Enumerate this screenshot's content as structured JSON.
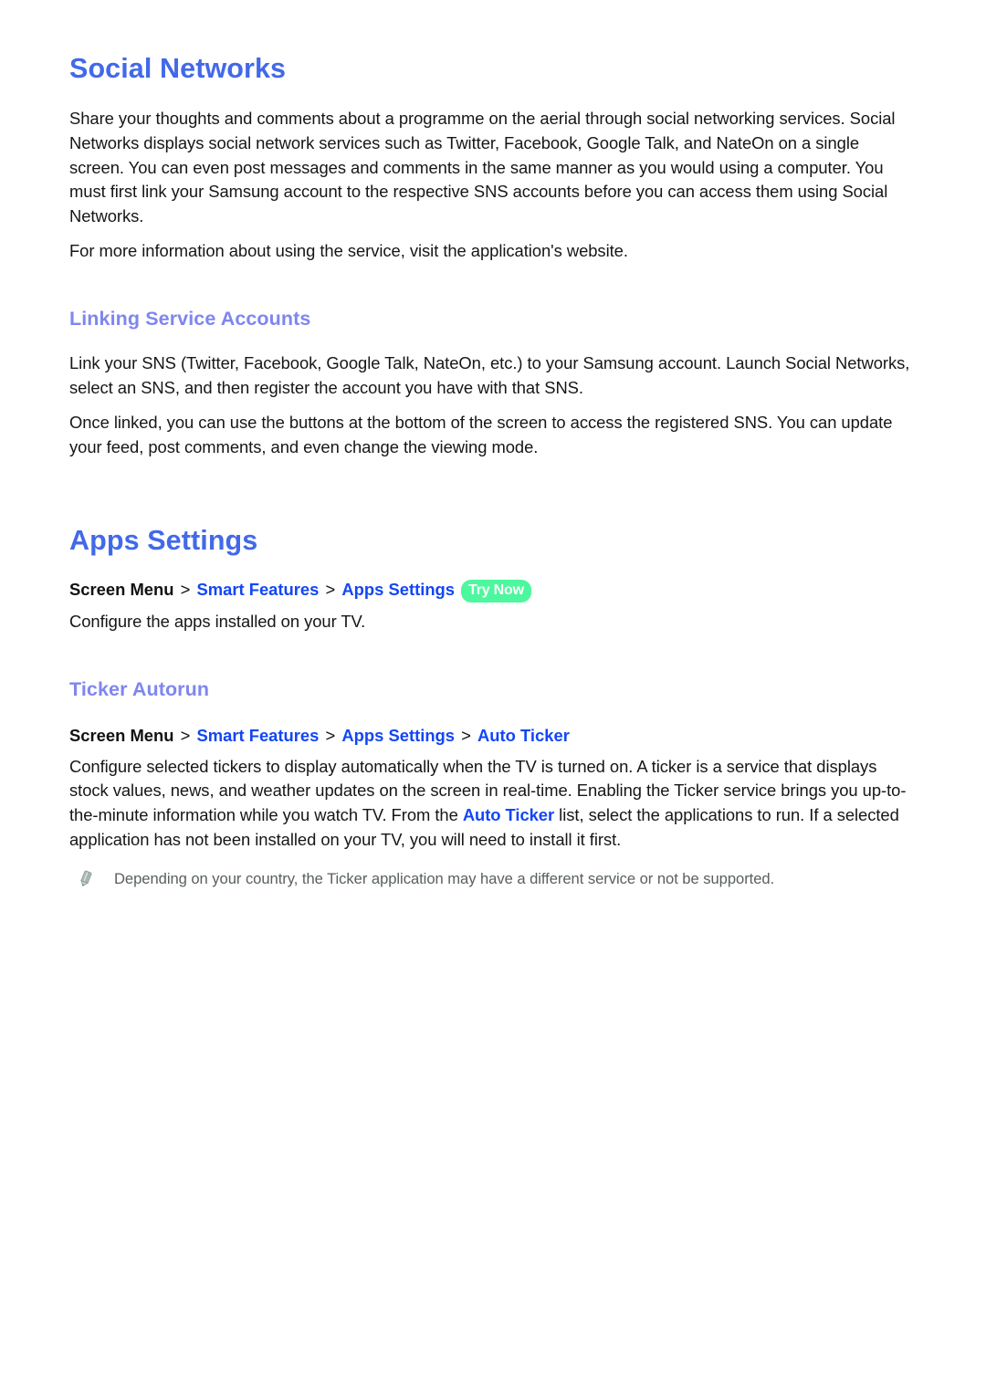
{
  "document": {
    "background_color": "#ffffff",
    "heading_color": "#4269e8",
    "subheading_color": "#7e86ef",
    "link_color": "#1246f5",
    "body_color": "#161616",
    "note_color": "#58605f",
    "badge_color": "#4df79e"
  },
  "sections": [
    {
      "title": "Social Networks",
      "paragraphs": [
        "Share your thoughts and comments about a programme on the aerial through social networking services. Social Networks displays social network services such as Twitter, Facebook, Google Talk, and NateOn on a single screen. You can even post messages and comments in the same manner as you would using a computer. You must first link your Samsung account to the respective SNS accounts before you can access them using Social Networks.",
        "For more information about using the service, visit the application's website."
      ],
      "subsection": {
        "title": "Linking Service Accounts",
        "paragraphs": [
          "Link your SNS (Twitter, Facebook, Google Talk, NateOn, etc.) to your Samsung account. Launch Social Networks, select an SNS, and then register the account you have with that SNS.",
          "Once linked, you can use the buttons at the bottom of the screen to access the registered SNS. You can update your feed, post comments, and even change the viewing mode."
        ]
      }
    },
    {
      "title": "Apps Settings",
      "breadcrumb": {
        "root": "Screen Menu",
        "separator": ">",
        "links": [
          "Smart Features",
          "Apps Settings"
        ],
        "badge": "Try Now"
      },
      "paragraphs": [
        "Configure the apps installed on your TV."
      ],
      "subsection": {
        "title": "Ticker Autorun",
        "breadcrumb": {
          "root": "Screen Menu",
          "separator": ">",
          "links": [
            "Smart Features",
            "Apps Settings",
            "Auto Ticker"
          ]
        },
        "paragraph_parts": {
          "before": "Configure selected tickers to display automatically when the TV is turned on. A ticker is a service that displays stock values, news, and weather updates on the screen in real-time. Enabling the Ticker service brings you up-to-the-minute information while you watch TV. From the ",
          "link": "Auto Ticker",
          "after": " list, select the applications to run. If a selected application has not been installed on your TV, you will need to install it first."
        },
        "note": {
          "icon": "pencil-icon",
          "text": "Depending on your country, the Ticker application may have a different service or not be supported."
        }
      }
    }
  ]
}
